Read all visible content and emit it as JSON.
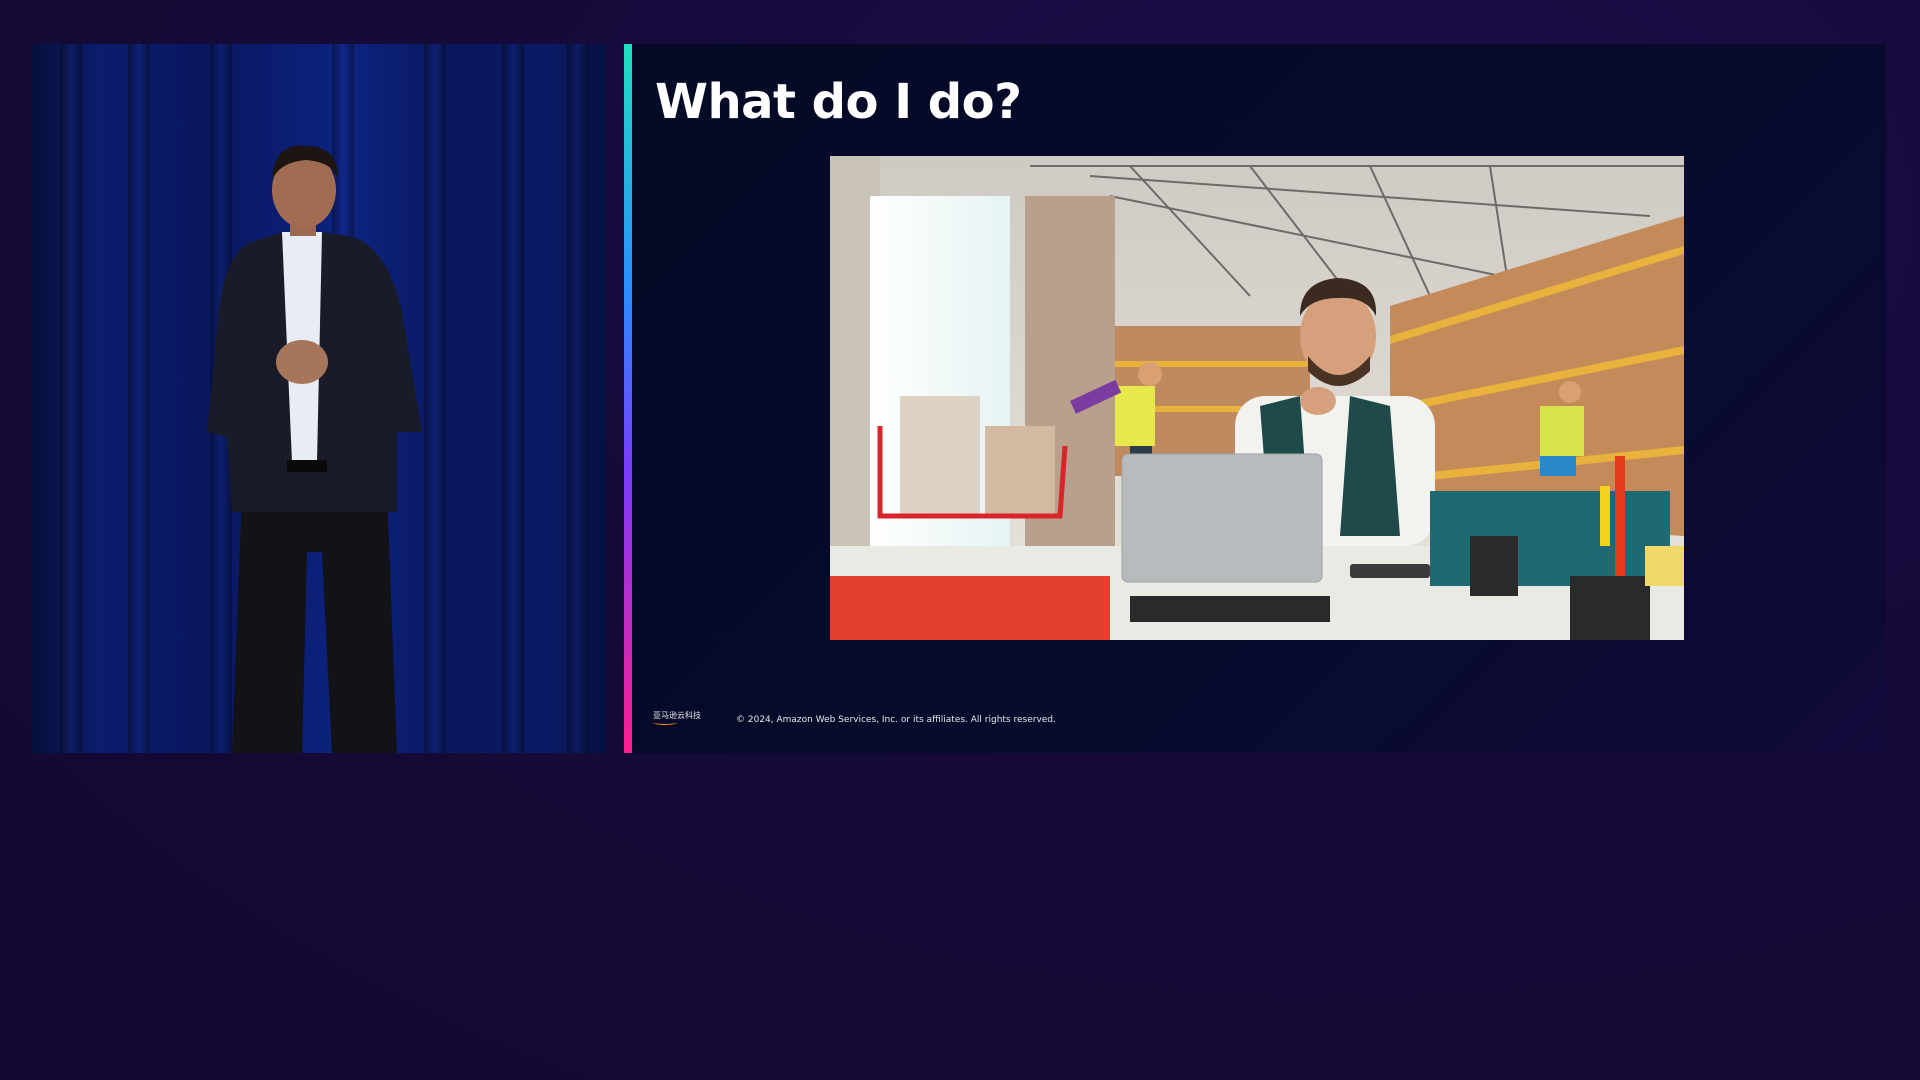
{
  "slide": {
    "title": "What do I do?",
    "footer_logo_text": "亚马逊云科技",
    "footer_copyright": "© 2024, Amazon Web Services, Inc. or its affiliates. All rights reserved.",
    "photo_icon": "warehouse-worker-laptop-photo"
  },
  "speaker_panel": {
    "icon": "presenter-video"
  },
  "colors": {
    "background": "#170a3a",
    "slide_background": "#060b2a",
    "accent_top": "#1fe0c0",
    "accent_mid": "#2a8cff",
    "accent_bottom": "#ff1d8e",
    "aws_orange": "#ff9900"
  }
}
